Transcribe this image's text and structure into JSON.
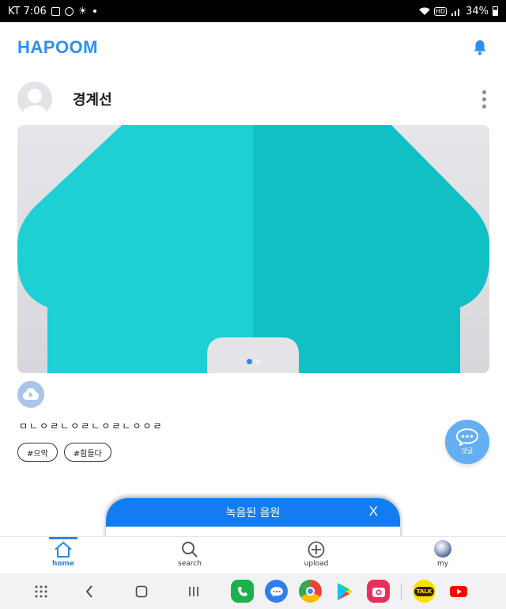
{
  "status_bar": {
    "carrier_time": "KT 7:06",
    "battery": "34%"
  },
  "header": {
    "brand": "HAPOOM"
  },
  "post": {
    "author": "경계선",
    "image_indicator": {
      "count": 2,
      "active": 0
    },
    "caption": "ㅁㄴㅇㄹㄴㅇㄹㄴㅇㄹㄴㅇㅇㄹ",
    "tags": [
      "#으악",
      "#힘들다"
    ]
  },
  "comment_fab": {
    "label": "댓글"
  },
  "recording_sheet": {
    "title": "녹음된 음원",
    "close": "X"
  },
  "bottom_nav": {
    "items": [
      {
        "label": "home",
        "icon": "home-icon",
        "active": true
      },
      {
        "label": "search",
        "icon": "search-icon"
      },
      {
        "label": "upload",
        "icon": "plus-circle-icon"
      },
      {
        "label": "my",
        "icon": "profile-avatar"
      }
    ]
  },
  "system_nav": {
    "apps": [
      "app-drawer-icon",
      "phone-app-icon",
      "messages-app-icon",
      "chrome-app-icon",
      "play-store-app-icon",
      "camera-app-icon",
      "kakaotalk-app-icon",
      "youtube-app-icon"
    ],
    "kakaotalk_label": "TALK"
  },
  "colors": {
    "brand": "#2f8ff0",
    "accent": "#137cf2",
    "teal": "#1ccfcf"
  }
}
